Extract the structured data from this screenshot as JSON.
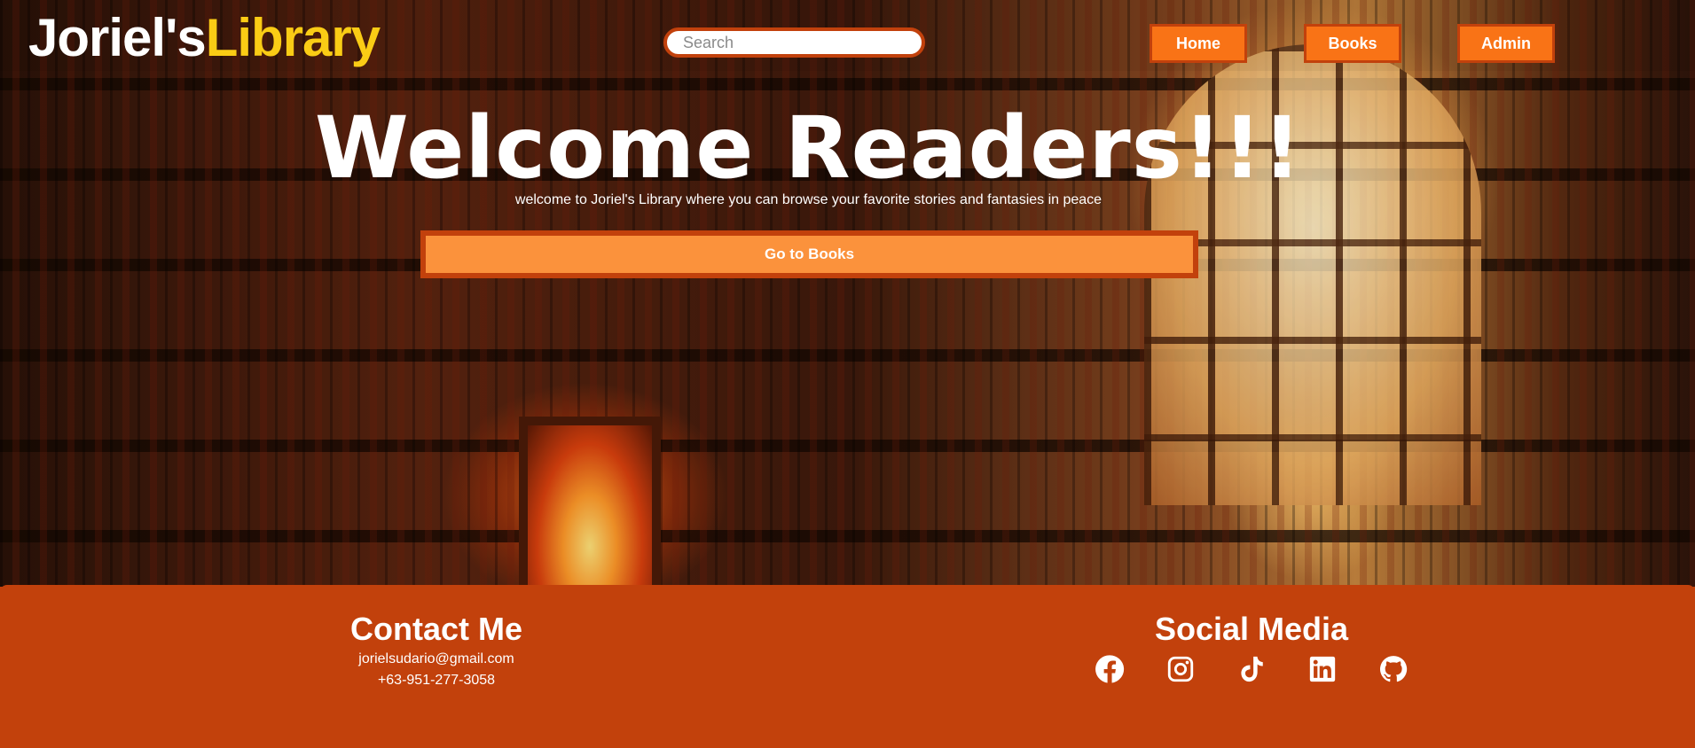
{
  "header": {
    "logo_part1": "Joriel's",
    "logo_part2": "Library",
    "search_placeholder": "Search",
    "nav": {
      "home": "Home",
      "books": "Books",
      "admin": "Admin"
    }
  },
  "hero": {
    "title": "Welcome Readers!!!",
    "subtitle": "welcome to Joriel's Library where you can browse your favorite stories and fantasies in peace",
    "cta_label": "Go to Books"
  },
  "footer": {
    "contact_title": "Contact Me",
    "email": "jorielsudario@gmail.com",
    "phone": "+63-951-277-3058",
    "social_title": "Social Media",
    "social_icons": [
      "facebook-icon",
      "instagram-icon",
      "tiktok-icon",
      "linkedin-icon",
      "github-icon"
    ]
  },
  "colors": {
    "accent": "#f97316",
    "accent_dark": "#c2410c",
    "logo_highlight": "#facc15",
    "cta": "#fb923c"
  }
}
